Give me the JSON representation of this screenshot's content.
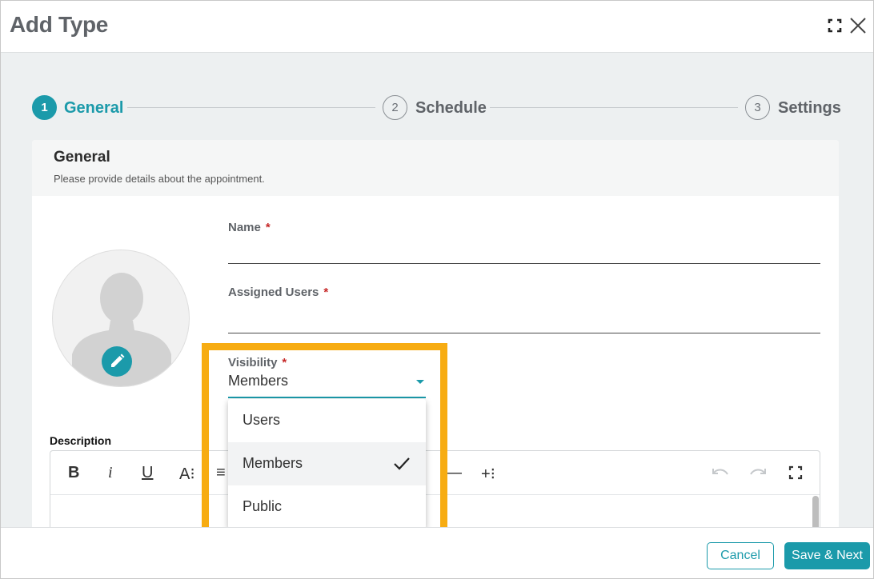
{
  "window": {
    "title": "Add Type"
  },
  "stepper": {
    "steps": [
      {
        "number": "1",
        "label": "General",
        "state": "active"
      },
      {
        "number": "2",
        "label": "Schedule",
        "state": "inactive"
      },
      {
        "number": "3",
        "label": "Settings",
        "state": "inactive"
      }
    ]
  },
  "section": {
    "title": "General",
    "subtitle": "Please provide details about the appointment."
  },
  "form": {
    "name": {
      "label": "Name",
      "required": "*",
      "value": ""
    },
    "assigned_users": {
      "label": "Assigned Users",
      "required": "*",
      "value": ""
    },
    "visibility": {
      "label": "Visibility",
      "required": "*",
      "value": "Members",
      "options": [
        "Users",
        "Members",
        "Public"
      ],
      "selected_index": 1
    },
    "description": {
      "label": "Description"
    }
  },
  "editor_toolbar": {
    "buttons": [
      "B",
      "i",
      "U",
      "A⁝",
      "≡",
      "—",
      "+⁝"
    ],
    "icons": [
      "bold-icon",
      "italic-icon",
      "underline-icon",
      "font-size-icon",
      "align-icon",
      "horizontal-rule-icon",
      "insert-icon",
      "undo-icon",
      "redo-icon",
      "fullscreen-icon"
    ]
  },
  "footer": {
    "cancel_label": "Cancel",
    "save_label": "Save & Next"
  },
  "colors": {
    "accent": "#1b9aaa",
    "highlight": "#f7ac12",
    "required": "#c62828"
  }
}
